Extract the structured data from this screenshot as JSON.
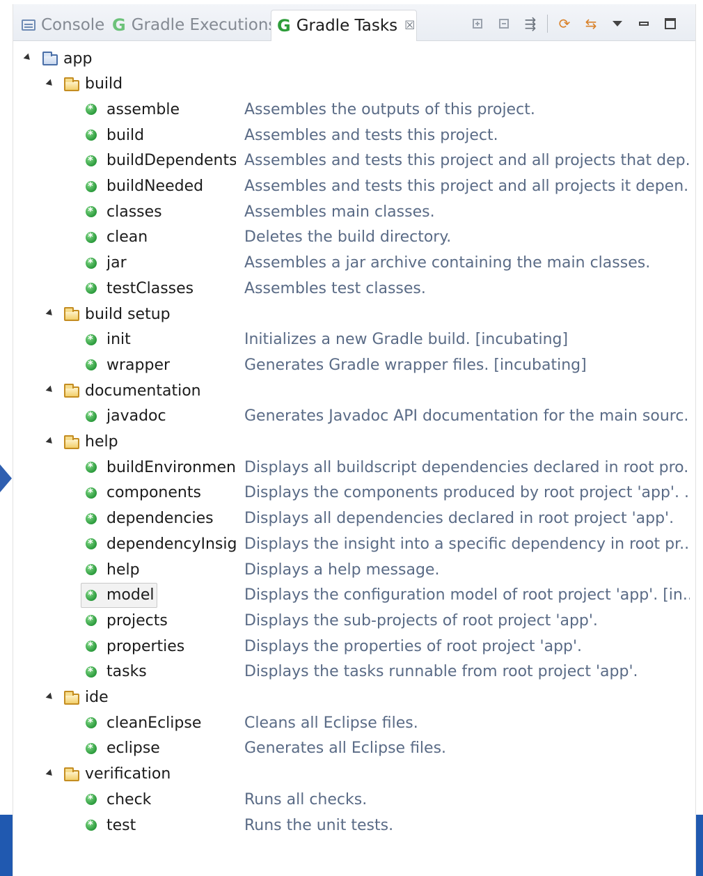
{
  "tabs": [
    {
      "label": "Console",
      "icon": "console-icon",
      "active": false
    },
    {
      "label": "Gradle Executions",
      "icon": "gradle-icon",
      "active": false
    },
    {
      "label": "Gradle Tasks",
      "icon": "gradle-icon",
      "active": true,
      "close_glyph": "☒"
    }
  ],
  "toolbar": {
    "buttons": [
      "expand-all-icon",
      "collapse-all-icon",
      "filter-icon",
      "refresh-icon",
      "link-with-selection-icon",
      "view-menu-icon",
      "minimize-icon",
      "maximize-icon"
    ]
  },
  "tree": {
    "root": "app",
    "groups": [
      {
        "name": "build",
        "tasks": [
          {
            "name": "assemble",
            "desc": "Assembles the outputs of this project."
          },
          {
            "name": "build",
            "desc": "Assembles and tests this project."
          },
          {
            "name": "buildDependents",
            "desc": "Assembles and tests this project and all projects that dep..."
          },
          {
            "name": "buildNeeded",
            "desc": "Assembles and tests this project and all projects it depen..."
          },
          {
            "name": "classes",
            "desc": "Assembles main classes."
          },
          {
            "name": "clean",
            "desc": "Deletes the build directory."
          },
          {
            "name": "jar",
            "desc": "Assembles a jar archive containing the main classes."
          },
          {
            "name": "testClasses",
            "desc": "Assembles test classes."
          }
        ]
      },
      {
        "name": "build setup",
        "tasks": [
          {
            "name": "init",
            "desc": "Initializes a new Gradle build. [incubating]"
          },
          {
            "name": "wrapper",
            "desc": "Generates Gradle wrapper files. [incubating]"
          }
        ]
      },
      {
        "name": "documentation",
        "tasks": [
          {
            "name": "javadoc",
            "desc": "Generates Javadoc API documentation for the main sourc..."
          }
        ]
      },
      {
        "name": "help",
        "tasks": [
          {
            "name": "buildEnvironment",
            "desc": "Displays all buildscript dependencies declared in root pro..."
          },
          {
            "name": "components",
            "desc": "Displays the components produced by root project 'app'. ..."
          },
          {
            "name": "dependencies",
            "desc": "Displays all dependencies declared in root project 'app'."
          },
          {
            "name": "dependencyInsight",
            "desc": "Displays the insight into a specific dependency in root pr..."
          },
          {
            "name": "help",
            "desc": "Displays a help message."
          },
          {
            "name": "model",
            "desc": "Displays the configuration model of root project 'app'. [in...",
            "selected": true
          },
          {
            "name": "projects",
            "desc": "Displays the sub-projects of root project 'app'."
          },
          {
            "name": "properties",
            "desc": "Displays the properties of root project 'app'."
          },
          {
            "name": "tasks",
            "desc": "Displays the tasks runnable from root project 'app'."
          }
        ]
      },
      {
        "name": "ide",
        "tasks": [
          {
            "name": "cleanEclipse",
            "desc": "Cleans all Eclipse files."
          },
          {
            "name": "eclipse",
            "desc": "Generates all Eclipse files."
          }
        ]
      },
      {
        "name": "verification",
        "tasks": [
          {
            "name": "check",
            "desc": "Runs all checks."
          },
          {
            "name": "test",
            "desc": "Runs the unit tests."
          }
        ]
      }
    ]
  },
  "colors": {
    "desc_text": "#5a6b86",
    "gradle_green": "#2e9d3a",
    "accent_blue": "#2059b0"
  }
}
